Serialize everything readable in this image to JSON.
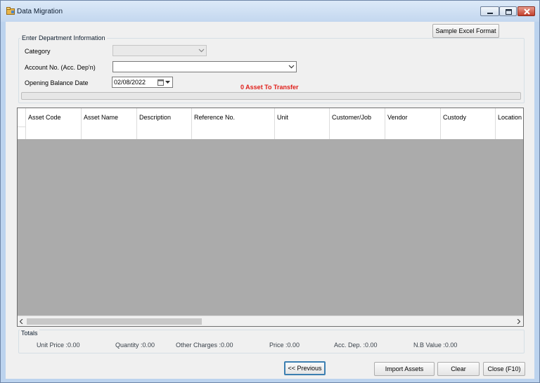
{
  "window": {
    "title": "Data Migration"
  },
  "buttons": {
    "sample_excel": "Sample Excel Format",
    "previous": "<< Previous",
    "import_assets": "Import Assets",
    "clear": "Clear",
    "close": "Close (F10)"
  },
  "department": {
    "group_title": "Enter Department Information",
    "category_label": "Category",
    "category_value": "",
    "account_label": "Account No. (Acc. Dep'n)",
    "account_value": "",
    "opening_date_label": "Opening Balance Date",
    "opening_date_value": "02/08/2022"
  },
  "transfer_status": "0 Asset To Transfer",
  "progress": 0,
  "grid": {
    "columns": [
      "Asset Code",
      "Asset Name",
      "Description",
      "Reference No.",
      "Unit",
      "Customer/Job",
      "Vendor",
      "Custody",
      "Location"
    ],
    "rows": []
  },
  "totals": {
    "title": "Totals",
    "unit_price": "Unit Price :0.00",
    "quantity": "Quantity :0.00",
    "other_charges": "Other Charges :0.00",
    "price": "Price :0.00",
    "acc_dep": "Acc. Dep. :0.00",
    "nb_value": "N.B Value :0.00"
  },
  "colors": {
    "transfer_status": "#e0201b",
    "progress_fill": "#06b025",
    "default_button_border": "#3c7fb1"
  },
  "icons": {
    "app": "app-icon",
    "minimize": "minimize-icon",
    "maximize": "maximize-icon",
    "close": "close-icon",
    "dropdown": "chevron-down-icon",
    "calendar": "calendar-icon"
  }
}
